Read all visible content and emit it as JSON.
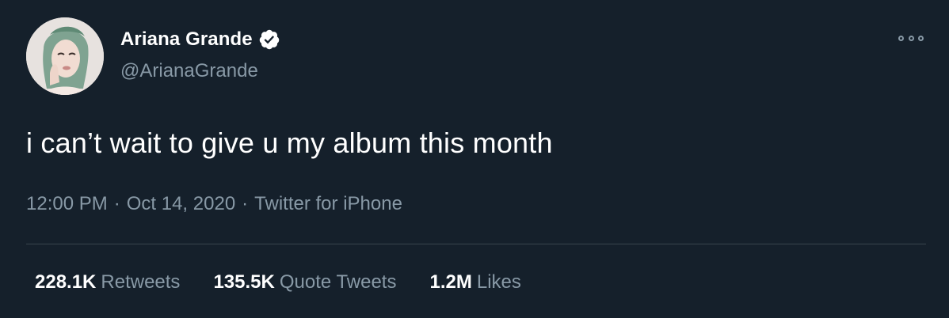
{
  "author": {
    "display_name": "Ariana Grande",
    "handle": "@ArianaGrande",
    "verified": true,
    "avatar_icon": "profile-photo"
  },
  "tweet": {
    "text": "i can’t wait to give u my album this month",
    "time": "12:00 PM",
    "date": "Oct 14, 2020",
    "source": "Twitter for iPhone",
    "separator": "·"
  },
  "stats": {
    "retweets": {
      "count": "228.1K",
      "label": "Retweets"
    },
    "quote_tweets": {
      "count": "135.5K",
      "label": "Quote Tweets"
    },
    "likes": {
      "count": "1.2M",
      "label": "Likes"
    }
  },
  "colors": {
    "background": "#15202b",
    "primary_text": "#ffffff",
    "secondary_text": "#8899a6",
    "divider": "#38444d"
  }
}
